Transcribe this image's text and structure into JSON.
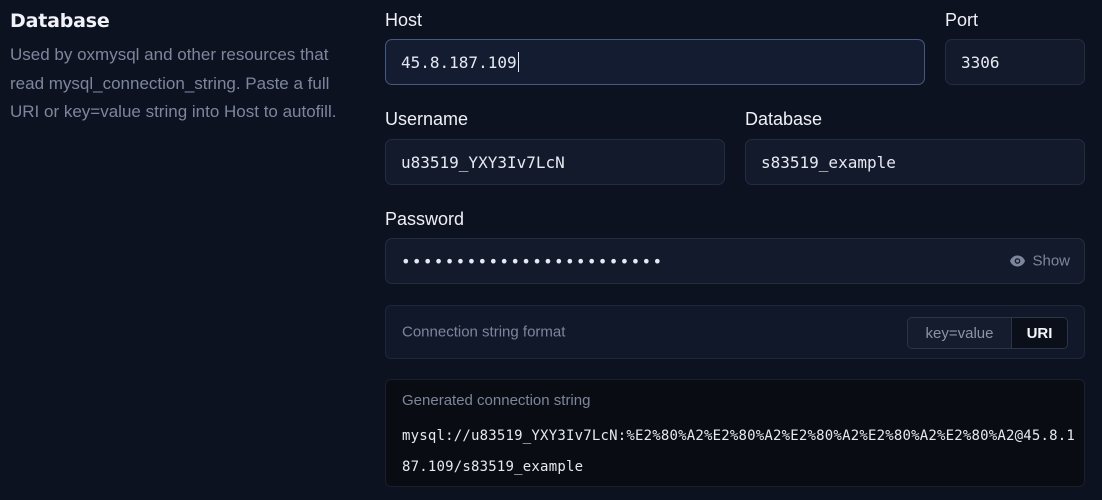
{
  "section": {
    "title": "Database",
    "description": "Used by oxmysql and other resources that read mysql_connection_string. Paste a full URI or key=value string into Host to autofill."
  },
  "fields": {
    "host": {
      "label": "Host",
      "value": "45.8.187.109"
    },
    "port": {
      "label": "Port",
      "value": "3306"
    },
    "username": {
      "label": "Username",
      "value": "u83519_YXY3Iv7LcN"
    },
    "database": {
      "label": "Database",
      "value": "s83519_example"
    },
    "password": {
      "label": "Password",
      "masked_value": "••••••••••••••••••••••••",
      "show_label": "Show",
      "show_icon": "eye-icon"
    }
  },
  "connection_format": {
    "label": "Connection string format",
    "options": [
      "key=value",
      "URI"
    ],
    "selected": "URI"
  },
  "generated": {
    "label": "Generated connection string",
    "value": "mysql://u83519_YXY3Iv7LcN:%E2%80%A2%E2%80%A2%E2%80%A2%E2%80%A2%E2%80%A2@45.8.187.109/s83519_example"
  },
  "colors": {
    "background": "#0d1221",
    "input_background": "#131a2c",
    "focused_border": "#45597e",
    "muted_text": "#7d869c"
  }
}
